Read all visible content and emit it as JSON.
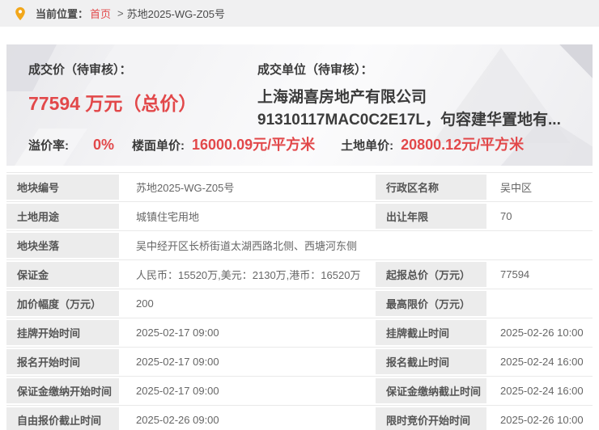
{
  "colors": {
    "accent_red": "#e2484a",
    "pin_amber": "#f2a71b",
    "label_cell_bg": "#ececec"
  },
  "breadcrumb": {
    "label": "当前位置：",
    "home": "首页",
    "separator": ">",
    "current": "苏地2025-WG-Z05号"
  },
  "deal": {
    "price_label": "成交价（待审核）：",
    "price_value": "77594 万元（总价）",
    "unit_label": "成交单位（待审核）：",
    "unit_line1": "上海湖喜房地产有限公司",
    "unit_line2": "91310117MAC0C2E17L，句容建华置地有...",
    "premium_label": "溢价率:",
    "premium_value": "0%",
    "floor_price_label": "楼面单价:",
    "floor_price_value": "16000.09元/平方米",
    "land_price_label": "土地单价:",
    "land_price_value": "20800.12元/平方米"
  },
  "table": {
    "rows": [
      {
        "label1": "地块编号",
        "value1": "苏地2025-WG-Z05号",
        "label2": "行政区名称",
        "value2": "吴中区"
      },
      {
        "label1": "土地用途",
        "value1": "城镇住宅用地",
        "label2": "出让年限",
        "value2": "70"
      },
      {
        "label1": "地块坐落",
        "value1": "吴中经开区长桥街道太湖西路北侧、西塘河东侧"
      },
      {
        "label1": "保证金",
        "value1": "人民币：15520万,美元：2130万,港币：16520万",
        "label2": "起报总价（万元）",
        "value2": "77594"
      },
      {
        "label1": "加价幅度（万元）",
        "value1": "200",
        "label2": "最高限价（万元）",
        "value2": ""
      },
      {
        "label1": "挂牌开始时间",
        "value1": "2025-02-17 09:00",
        "label2": "挂牌截止时间",
        "value2": "2025-02-26 10:00"
      },
      {
        "label1": "报名开始时间",
        "value1": "2025-02-17 09:00",
        "label2": "报名截止时间",
        "value2": "2025-02-24 16:00"
      },
      {
        "label1": "保证金缴纳开始时间",
        "value1": "2025-02-17 09:00",
        "label2": "保证金缴纳截止时间",
        "value2": "2025-02-24 16:00"
      },
      {
        "label1": "自由报价截止时间",
        "value1": "2025-02-26 09:00",
        "label2": "限时竞价开始时间",
        "value2": "2025-02-26 10:00"
      }
    ]
  }
}
